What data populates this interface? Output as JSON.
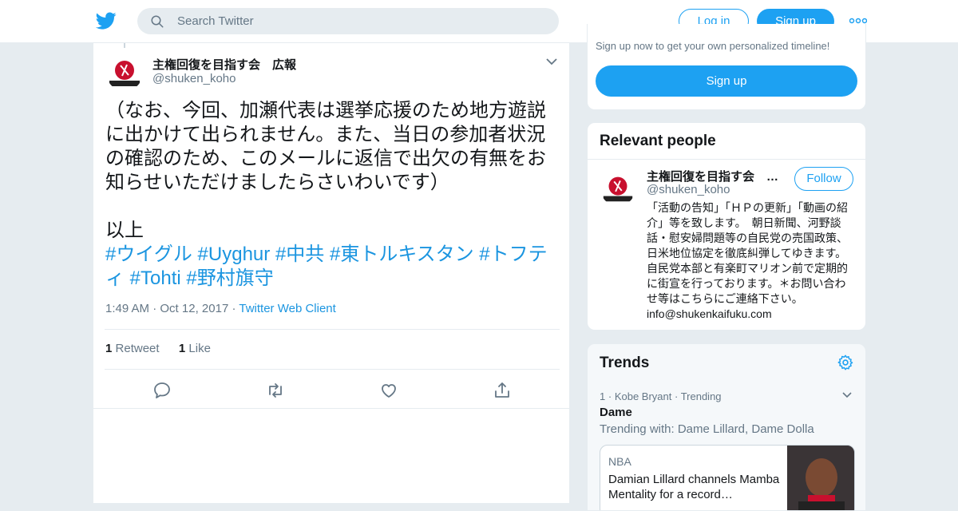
{
  "header": {
    "search_placeholder": "Search Twitter",
    "login_label": "Log in",
    "signup_label": "Sign up",
    "brand_color": "#1da1f2"
  },
  "tweet": {
    "display_name": "主権回復を目指す会　広報",
    "handle": "@shuken_koho",
    "text": "（なお、今回、加瀬代表は選挙応援のため地方遊説に出かけて出られません。また、当日の参加者状況の確認のため、このメールに返信で出欠の有無をお知らせいただけましたらさいわいです）\n\n以上",
    "hashtags": [
      "#ウイグル",
      "#Uyghur",
      "#中共",
      "#東トルキスタン",
      "#トフティ",
      "#Tohti",
      "#野村旗守"
    ],
    "time": "1:49 AM",
    "date": "Oct 12, 2017",
    "client": "Twitter Web Client",
    "retweet_count": "1",
    "retweet_label": "Retweet",
    "like_count": "1",
    "like_label": "Like"
  },
  "signup_card": {
    "prompt": "Sign up now to get your own personalized timeline!",
    "button_label": "Sign up"
  },
  "relevant_people": {
    "title": "Relevant people",
    "name": "主権回復を目指す会　広報",
    "handle": "@shuken_koho",
    "follow_label": "Follow",
    "bio": "「活動の告知」「ＨＰの更新」「動画の紹介」等を致します。　朝日新聞、河野談話・慰安婦問題等の自民党の売国政策、日米地位協定を徹底糾弾してゆきます。　自民党本部と有楽町マリオン前で定期的に街宣を行っております。＊お問い合わせ等はこちらにご連絡下さい。info@shukenkaifuku.com"
  },
  "trends": {
    "title": "Trends",
    "item": {
      "rank": "1",
      "context": "Kobe Bryant",
      "status": "Trending",
      "name": "Dame",
      "trending_with": "Trending with: Dame Lillard, Dame Dolla",
      "news_source": "NBA",
      "news_headline": "Damian Lillard channels Mamba Mentality for a record…"
    }
  }
}
